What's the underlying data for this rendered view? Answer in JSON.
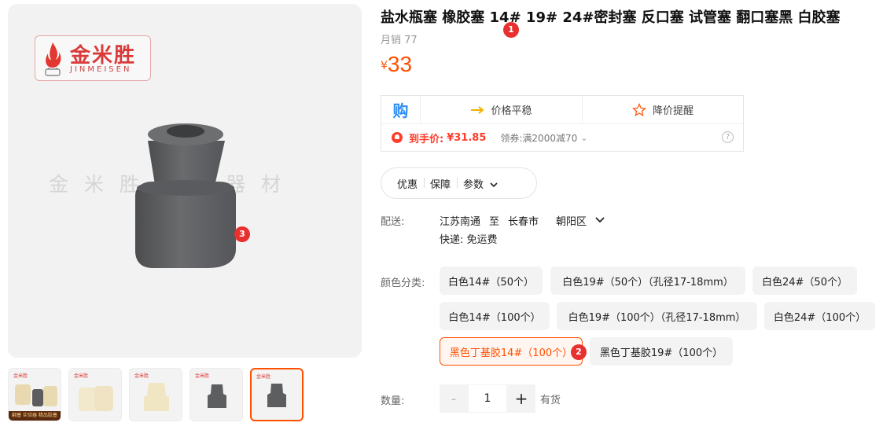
{
  "logo": {
    "main_text": "金米胜",
    "sub_text": "JINMEISEN"
  },
  "watermark": "金米胜实验器材",
  "product": {
    "title": "盐水瓶塞 橡胶塞 14# 19# 24#密封塞 反口塞 试管塞 翻口塞黑 白胶塞",
    "sales_label": "月销",
    "sales_count": "77",
    "currency": "¥",
    "price": "33"
  },
  "promo": {
    "buy_logo": "购",
    "trend_label": "价格平稳",
    "alert_label": "降价提醒",
    "hand_price_label": "到手价:",
    "hand_price_value": "¥31.85",
    "coupon_text": "领券:满2000减70",
    "help_glyph": "?"
  },
  "tabs": [
    {
      "label": "优惠"
    },
    {
      "label": "保障"
    },
    {
      "label": "参数"
    }
  ],
  "shipping": {
    "label": "配送:",
    "from": "江苏南通",
    "to_word": "至",
    "city": "长春市",
    "district": "朝阳区",
    "express": "快递: 免运费"
  },
  "color": {
    "label": "颜色分类:",
    "options": [
      {
        "label": "白色14#（50个）"
      },
      {
        "label": "白色19#（50个）（孔径17-18mm）"
      },
      {
        "label": "白色24#（50个）"
      },
      {
        "label": "白色14#（100个）"
      },
      {
        "label": "白色19#（100个）（孔径17-18mm）"
      },
      {
        "label": "白色24#（100个）"
      },
      {
        "label": "黑色丁基胶14#（100个）"
      },
      {
        "label": "黑色丁基胶19#（100个）"
      }
    ],
    "selected": "黑色丁基胶14#（100个）"
  },
  "quantity": {
    "label": "数量:",
    "minus": "-",
    "value": "1",
    "plus": "+",
    "stock": "有货"
  },
  "thumbnails": [
    {
      "band_text": "翻塞 实验器 精品胶塞"
    },
    {
      "band_text": ""
    },
    {
      "band_text": ""
    },
    {
      "band_text": ""
    },
    {
      "band_text": ""
    }
  ],
  "badges": [
    "1",
    "2",
    "3"
  ],
  "colors": {
    "accent": "#ff5000",
    "badge_red": "#e8302f",
    "buy_blue": "#2f8ef4",
    "product_gray": "#5f6062"
  }
}
